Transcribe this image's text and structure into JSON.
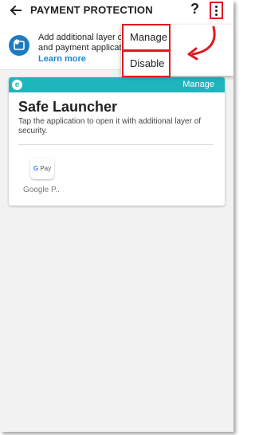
{
  "header": {
    "title": "PAYMENT PROTECTION",
    "back_icon": "arrow-left-icon",
    "help_label": "?",
    "overflow_icon": "more-vert-icon"
  },
  "banner": {
    "line1": "Add additional layer o",
    "line2": "and payment applicat",
    "link": "Learn more",
    "icon": "shield-icon"
  },
  "menu": {
    "items": [
      {
        "label": "Manage"
      },
      {
        "label": "Disable"
      }
    ]
  },
  "card": {
    "badge": "e",
    "manage_label": "Manage",
    "title": "Safe Launcher",
    "description": "Tap the application to open it with additional layer of security.",
    "apps": [
      {
        "icon_text": "Pay",
        "label": "Google P.."
      }
    ]
  },
  "colors": {
    "accent": "#1fb5be",
    "link": "#1e88c8",
    "highlight": "#e0191f"
  }
}
